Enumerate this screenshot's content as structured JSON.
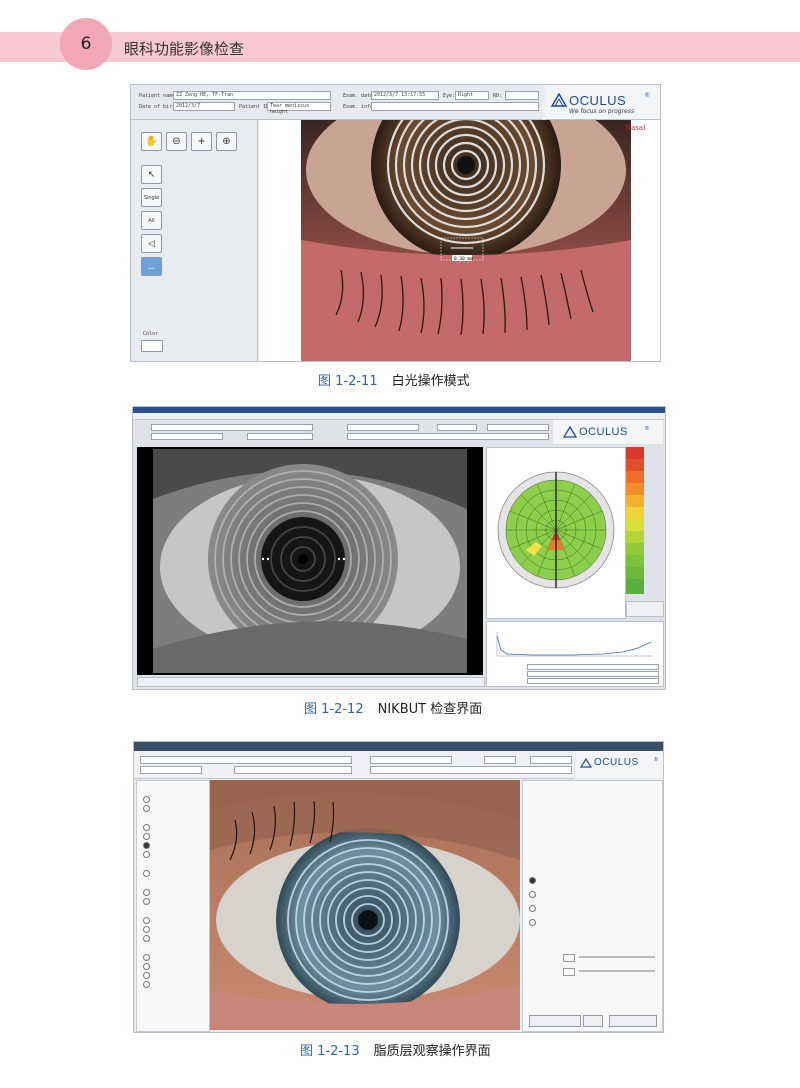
{
  "header": {
    "page_number": "6",
    "chapter_title": "眼科功能影像检查"
  },
  "figures": [
    {
      "number": "图 1-2-11",
      "title": "白光操作模式"
    },
    {
      "number": "图 1-2-12",
      "title": "NIKBUT 检查界面"
    },
    {
      "number": "图 1-2-13",
      "title": "脂质层观察操作界面"
    }
  ],
  "fig1": {
    "labels": {
      "patient_name": "Patient name:",
      "dob": "Date of birth:",
      "patient_id": "Patient ID:",
      "exam_date": "Exam. date:",
      "exam_info": "Exam. info:",
      "eye": "Eye:",
      "rd": "RD:"
    },
    "values": {
      "patient_name": "ZZ Zeng HE, TF-Tran",
      "dob": "2012/3/7",
      "patient_id": "Tear meniscus height",
      "exam_date": "2012/3/7 13:17:55",
      "eye": "Right"
    },
    "brand": "OCULUS",
    "brand_mark": "®",
    "slogan": "We focus on progress",
    "tool_single": "Single",
    "tool_all": "All",
    "color_label": "Color",
    "nasal": "Nasal",
    "measure": "0.30 mm"
  },
  "fig2": {
    "brand": "OCULUS",
    "brand_mark": "®"
  },
  "fig3": {
    "brand": "OCULUS",
    "brand_mark": "®"
  }
}
